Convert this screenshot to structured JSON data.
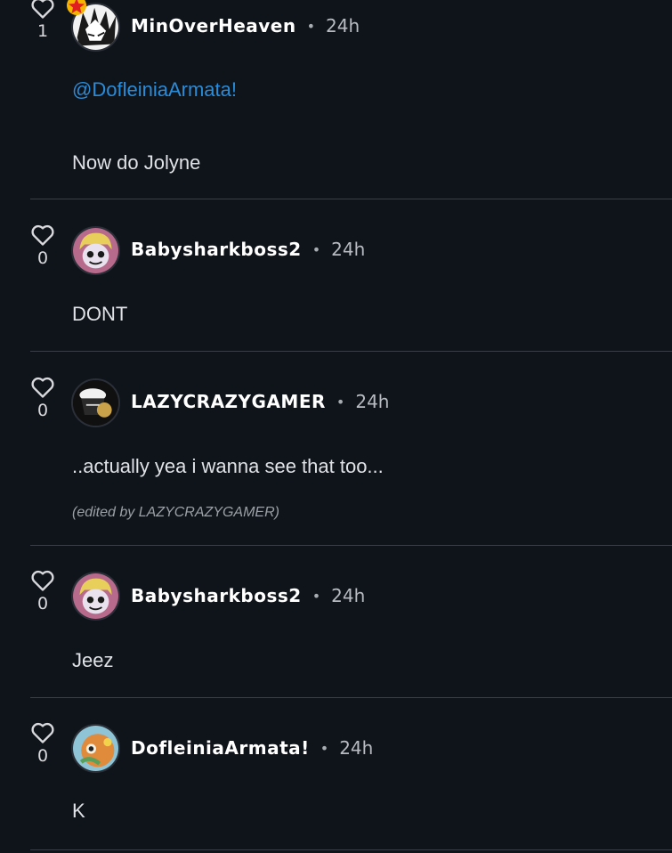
{
  "colors": {
    "background": "#0f131a",
    "mention": "#2a8cd9",
    "divider": "#3a3f47",
    "badge": "#e02020"
  },
  "comments": [
    {
      "likes": "1",
      "username": "MinOverHeaven",
      "time": "24h",
      "avatar_icon": "anime-character-avatar-icon",
      "mention": "@DofleiniaArmata!",
      "text": "Now do Jolyne"
    },
    {
      "likes": "0",
      "username": "Babysharkboss2",
      "time": "24h",
      "avatar_icon": "blonde-character-avatar-icon",
      "text": "DONT"
    },
    {
      "likes": "0",
      "username": "LAZYCRAZYGAMER",
      "time": "24h",
      "avatar_icon": "dark-character-avatar-icon",
      "text": "..actually yea i wanna see that too...",
      "edited": "(edited by LAZYCRAZYGAMER)"
    },
    {
      "likes": "0",
      "username": "Babysharkboss2",
      "time": "24h",
      "avatar_icon": "blonde-character-avatar-icon",
      "text": "Jeez"
    },
    {
      "likes": "0",
      "username": "DofleiniaArmata!",
      "time": "24h",
      "avatar_icon": "orange-character-avatar-icon",
      "text": "K"
    }
  ],
  "separator": "•"
}
